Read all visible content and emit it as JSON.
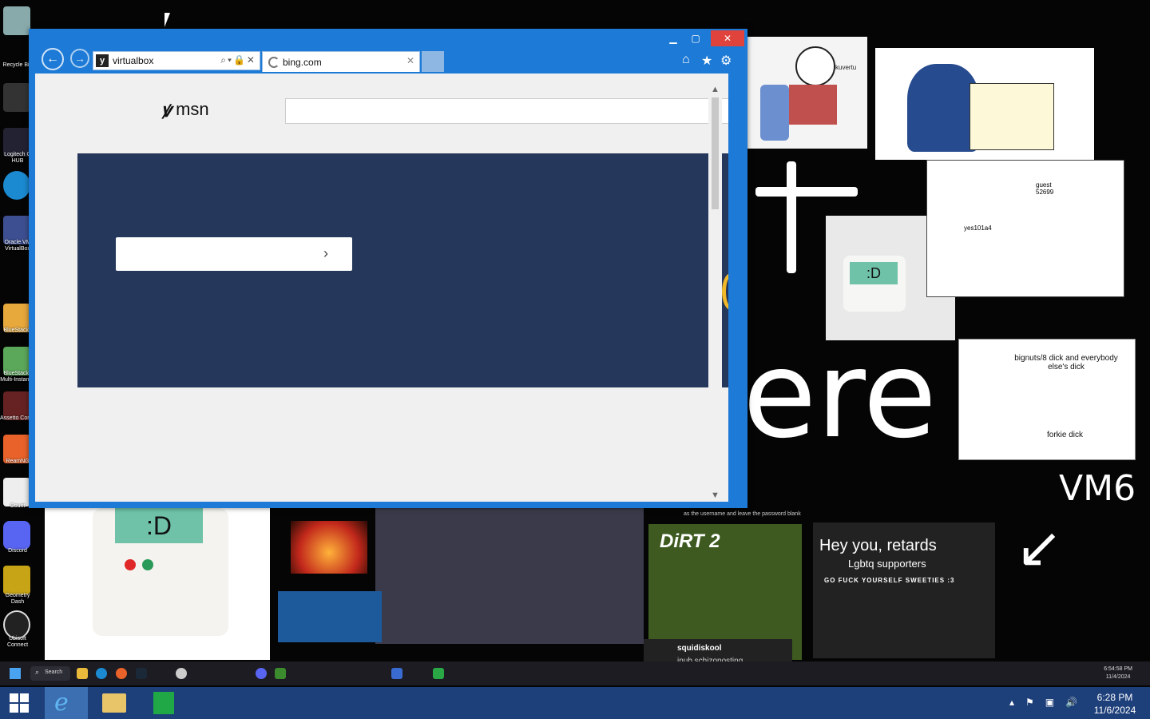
{
  "desktop": {
    "icons": [
      {
        "label": "Recycle Bin"
      },
      {
        "label": "Epic Games Launcher"
      },
      {
        "label": "Logitech G HUB"
      },
      {
        "label": "Microsoft Edge"
      },
      {
        "label": "Oracle VM VirtualBox"
      },
      {
        "label": "BlueStacks"
      },
      {
        "label": "BlueStacks Multi-Instance"
      },
      {
        "label": "Assetto Corsa"
      },
      {
        "label": "ReamNG"
      },
      {
        "label": "Count"
      },
      {
        "label": "Discord"
      },
      {
        "label": "Geometry Dash"
      },
      {
        "label": "Ubisoft Connect"
      }
    ],
    "wallpaper_text": {
      "big_word": "ere",
      "vm_tag": "VM6",
      "cartoon_name": "kuvertu",
      "bignuts_note": "bignuts/8 dick and everybody else's dick",
      "forkie": "forkie dick",
      "guest_tag": "guest 52699",
      "yes_tag": "yes101a4",
      "hey_title": "Hey you, retards",
      "hey_sub": "Lgbtq supporters",
      "hey_sub2": "GO FUCK YOURSELF SWEETIES :3",
      "dirt": "DiRT 2",
      "squid_user": "squidiskool",
      "squid_msg": "inub schizoposting",
      "tip_text": "as the username and leave the password blank",
      "face": ":D"
    },
    "inner_taskbar": {
      "search": "Search",
      "time": "6:54:58 PM",
      "date": "11/4/2024"
    }
  },
  "browser": {
    "address": "virtualbox",
    "tab_title": "bing.com",
    "page": {
      "logo_text": "msn",
      "search_value": "",
      "hero_input_value": "",
      "hero_arrow": "›"
    }
  },
  "taskbar": {
    "time": "6:28 PM",
    "date": "11/6/2024"
  },
  "colors": {
    "window_frame": "#1d7ad6",
    "close_button": "#e0433b",
    "hero_bg": "#25375a",
    "taskbar_bg": "#1d3f7a"
  }
}
